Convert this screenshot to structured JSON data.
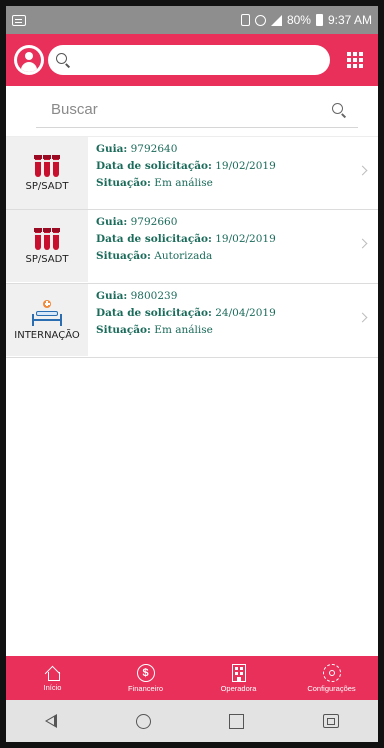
{
  "status_bar": {
    "battery": "80%",
    "time": "9:37 AM"
  },
  "header": {
    "search_placeholder": ""
  },
  "search": {
    "placeholder": "Buscar"
  },
  "items": [
    {
      "category": "SP/SADT",
      "icon": "test-tubes-icon",
      "guia_label": "Guia:",
      "guia": "9792640",
      "data_label": "Data de solicitação:",
      "data": "19/02/2019",
      "situacao_label": "Situação:",
      "situacao": "Em análise"
    },
    {
      "category": "SP/SADT",
      "icon": "test-tubes-icon",
      "guia_label": "Guia:",
      "guia": "9792660",
      "data_label": "Data de solicitação:",
      "data": "19/02/2019",
      "situacao_label": "Situação:",
      "situacao": "Autorizada"
    },
    {
      "category": "INTERNAÇÃO",
      "icon": "hospital-bed-icon",
      "guia_label": "Guia:",
      "guia": "9800239",
      "data_label": "Data de solicitação:",
      "data": "24/04/2019",
      "situacao_label": "Situação:",
      "situacao": "Em análise"
    }
  ],
  "tabbar": {
    "tabs": [
      {
        "label": "Início",
        "icon": "home-icon"
      },
      {
        "label": "Financeiro",
        "icon": "money-icon"
      },
      {
        "label": "Operadora",
        "icon": "building-icon"
      },
      {
        "label": "Configurações",
        "icon": "gear-icon"
      }
    ]
  },
  "colors": {
    "brand": "#e8305a",
    "text_accent": "#1b6b5a"
  }
}
